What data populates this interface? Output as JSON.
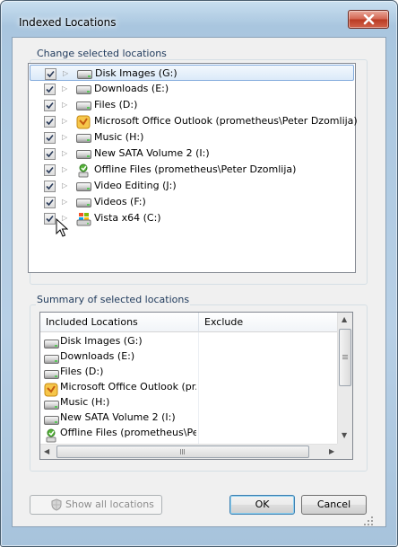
{
  "window": {
    "title": "Indexed Locations"
  },
  "change_section": {
    "label": "Change selected locations",
    "items": [
      {
        "label": "Disk Images (G:)",
        "icon": "drive-icon",
        "checked": true,
        "selected": true
      },
      {
        "label": "Downloads (E:)",
        "icon": "drive-icon",
        "checked": true
      },
      {
        "label": "Files (D:)",
        "icon": "drive-icon",
        "checked": true
      },
      {
        "label": "Microsoft Office Outlook (prometheus\\Peter Dzomlija)",
        "icon": "outlook-icon",
        "checked": true
      },
      {
        "label": "Music (H:)",
        "icon": "drive-icon",
        "checked": true
      },
      {
        "label": "New SATA Volume 2 (I:)",
        "icon": "drive-icon",
        "checked": true
      },
      {
        "label": "Offline Files (prometheus\\Peter Dzomlija)",
        "icon": "offline-files-icon",
        "checked": true
      },
      {
        "label": "Video Editing (J:)",
        "icon": "drive-icon",
        "checked": true
      },
      {
        "label": "Videos (F:)",
        "icon": "drive-icon",
        "checked": true
      },
      {
        "label": "Vista x64 (C:)",
        "icon": "windows-drive-icon",
        "checked": true
      }
    ]
  },
  "summary_section": {
    "label": "Summary of selected locations",
    "columns": [
      "Included Locations",
      "Exclude"
    ],
    "rows": [
      {
        "included": "Disk Images (G:)",
        "icon": "drive-icon"
      },
      {
        "included": "Downloads (E:)",
        "icon": "drive-icon"
      },
      {
        "included": "Files (D:)",
        "icon": "drive-icon"
      },
      {
        "included": "Microsoft Office Outlook (pr...",
        "icon": "outlook-icon"
      },
      {
        "included": "Music (H:)",
        "icon": "drive-icon"
      },
      {
        "included": "New SATA Volume 2 (I:)",
        "icon": "drive-icon"
      },
      {
        "included": "Offline Files (prometheus\\Pe...",
        "icon": "offline-files-icon"
      }
    ]
  },
  "buttons": {
    "show_all": "Show all locations",
    "ok": "OK",
    "cancel": "Cancel"
  },
  "colors": {
    "accent": "#1e395b",
    "selection": "#dbeaf9"
  }
}
